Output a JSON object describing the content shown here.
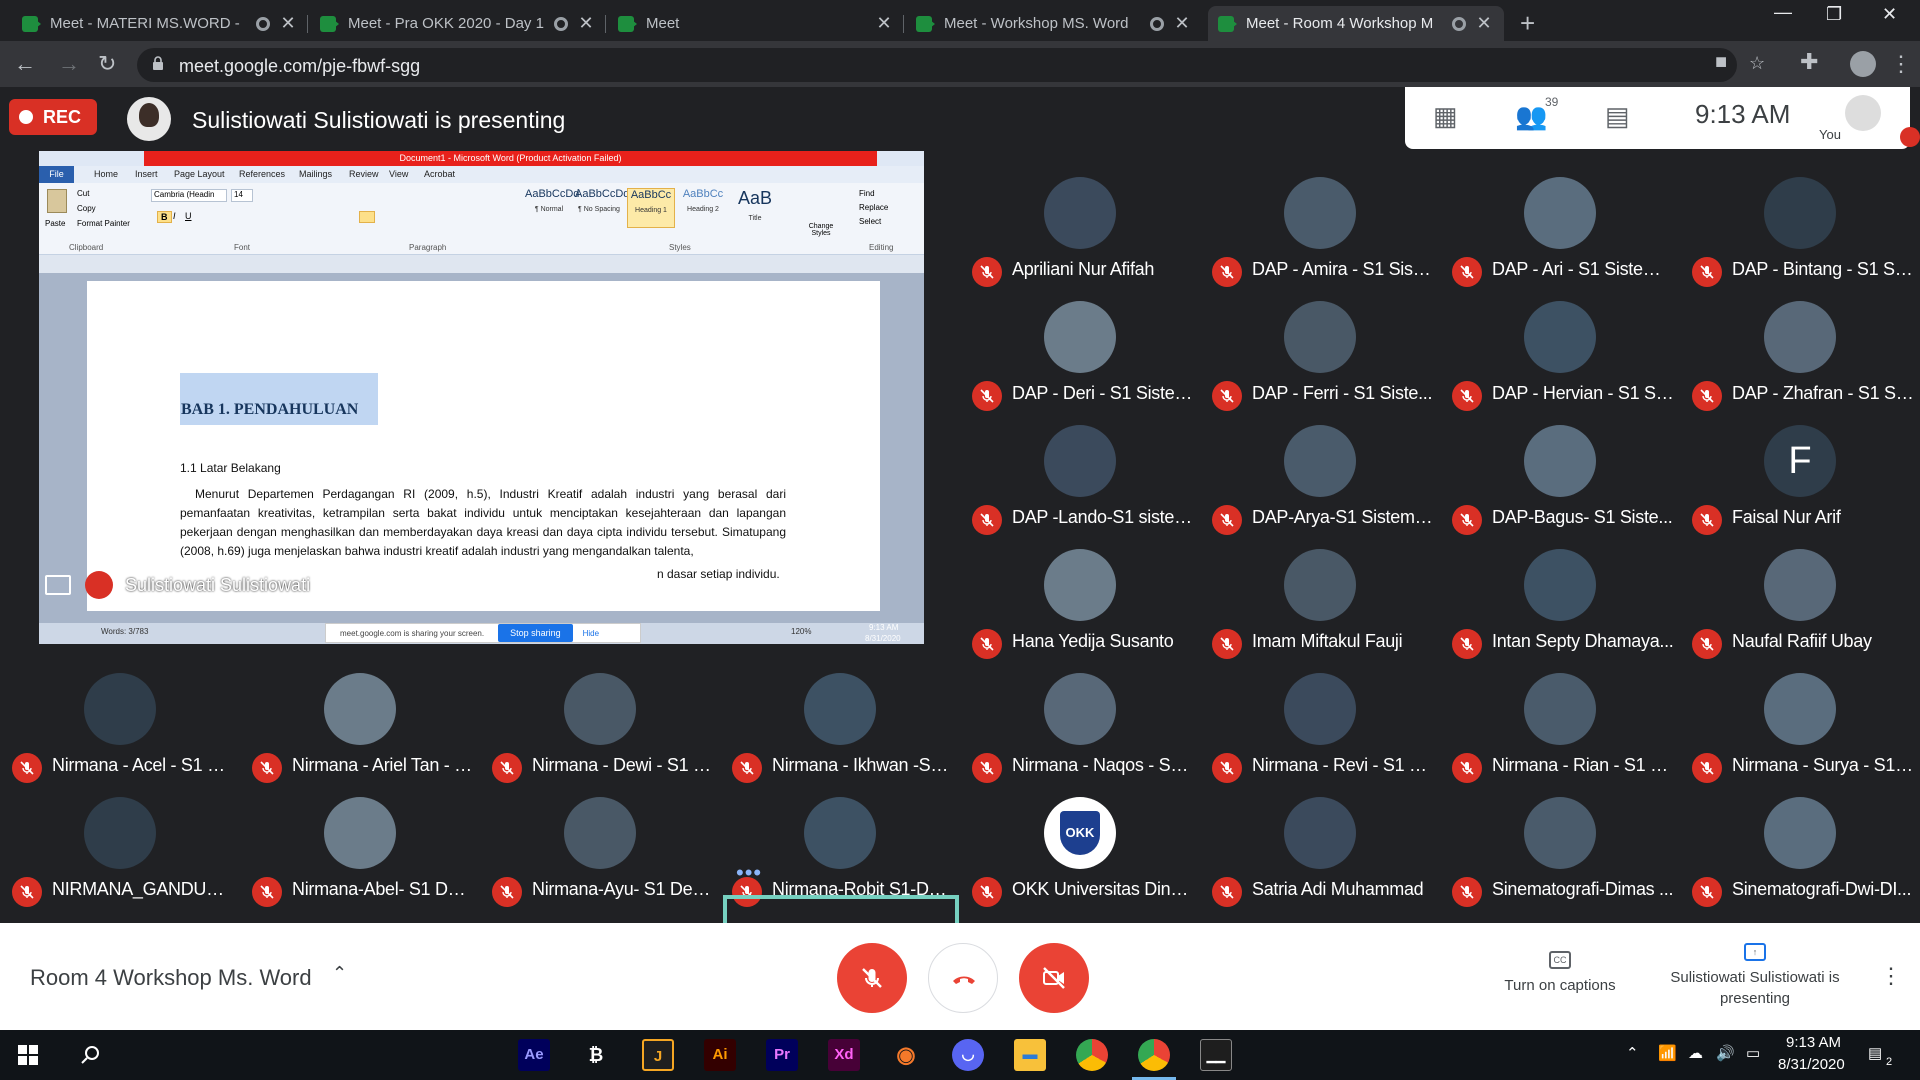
{
  "browser": {
    "tabs": [
      {
        "title": "Meet - MATERI MS.WORD - ",
        "recording": true
      },
      {
        "title": "Meet - Pra OKK 2020 - Day 1",
        "recording": true
      },
      {
        "title": "Meet",
        "recording": false
      },
      {
        "title": "Meet - Workshop MS. Word",
        "recording": true
      },
      {
        "title": "Meet - Room 4 Workshop M",
        "recording": true,
        "active": true
      }
    ],
    "url": "meet.google.com/pje-fbwf-sgg"
  },
  "meet": {
    "rec_label": "REC",
    "presenting_title": "Sulistiowati Sulistiowati is presenting",
    "participant_count": "39",
    "time": "9:13 AM",
    "you_label": "You",
    "shared_screen": {
      "window_title": "Document1 - Microsoft Word (Product Activation Failed)",
      "ribbon_tabs": [
        "File",
        "Home",
        "Insert",
        "Page Layout",
        "References",
        "Mailings",
        "Review",
        "View",
        "Acrobat"
      ],
      "font_name": "Cambria (Headin",
      "font_size": "14",
      "groups": [
        "Clipboard",
        "Font",
        "Paragraph",
        "Styles",
        "Editing"
      ],
      "clipboard_items": [
        "Paste",
        "Cut",
        "Copy",
        "Format Painter"
      ],
      "styles": [
        {
          "preview": "AaBbCcDd",
          "name": "¶ Normal"
        },
        {
          "preview": "AaBbCcDd",
          "name": "¶ No Spacing"
        },
        {
          "preview": "AaBbCc",
          "name": "Heading 1"
        },
        {
          "preview": "AaBbCc",
          "name": "Heading 2"
        },
        {
          "preview": "AaB",
          "name": "Title"
        }
      ],
      "change_styles": "Change Styles",
      "editing": [
        "Find",
        "Replace",
        "Select"
      ],
      "heading": "BAB 1. PENDAHULUAN",
      "subheading": "1.1 Latar Belakang",
      "body": "Menurut Departemen Perdagangan RI (2009, h.5), Industri Kreatif adalah industri yang berasal dari pemanfaatan kreativitas, ketrampilan serta bakat individu untuk menciptakan kesejahteraan dan lapangan pekerjaan dengan menghasilkan dan memberdayakan daya kreasi dan daya cipta individu tersebut. Simatupang (2008, h.69) juga menjelaskan bahwa industri kreatif adalah industri yang mengandalkan talenta,",
      "body_tail": "n dasar setiap individu.",
      "status_words": "Words: 3/783",
      "share_notice": "meet.google.com is sharing your screen.",
      "stop_sharing": "Stop sharing",
      "hide": "Hide",
      "zoom": "120%",
      "clock_time": "9:13 AM",
      "clock_date": "8/31/2020"
    },
    "presenter_name": "Sulistiowati Sulistiowati",
    "participants_right": [
      "Apriliani Nur Afifah",
      "DAP - Amira - S1 Siste...",
      "DAP - Ari - S1 Sistem I...",
      "DAP - Bintang - S1 Sis...",
      "DAP - Deri - S1 Sistem...",
      "DAP - Ferri - S1 Siste...",
      "DAP - Hervian - S1 Sis...",
      "DAP - Zhafran - S1 Sis...",
      "DAP -Lando-S1 sistem...",
      "DAP-Arya-S1 Sistem I...",
      "DAP-Bagus- S1 Siste...",
      "Faisal Nur Arif",
      "Hana Yedija Susanto",
      "Imam Miftakul Fauji",
      "Intan Septy Dhamaya...",
      "Naufal Rafiif Ubay"
    ],
    "faisal_initial": "F",
    "participants_bottom": [
      "Nirmana - Acel - S1 De...",
      "Nirmana - Ariel Tan - S...",
      "Nirmana - Dewi - S1 D...",
      "Nirmana - Ikhwan -S1 ...",
      "Nirmana - Naqos - S1 ...",
      "Nirmana - Revi - S1 De...",
      "Nirmana - Rian - S1 De...",
      "Nirmana - Surya - S1 D...",
      "NIRMANA_GANDUNG...",
      "Nirmana-Abel- S1 Des...",
      "Nirmana-Ayu- S1 Desa...",
      "Nirmana-Robit S1-Des...",
      "OKK Universitas Dina...",
      "Satria Adi Muhammad",
      "Sinematografi-Dimas ...",
      "Sinematografi-Dwi-DI..."
    ],
    "okk_logo_text": "OKK",
    "meeting_name": "Room 4 Workshop Ms. Word",
    "captions_label": "Turn on captions",
    "presenting_label": "Sulistiowati Sulistiowati is presenting",
    "accent_red": "#ea4335"
  },
  "taskbar": {
    "apps": [
      "Ae",
      "Ai",
      "Pr",
      "Xd"
    ],
    "time": "9:13 AM",
    "date": "8/31/2020",
    "notif_count": "2"
  }
}
